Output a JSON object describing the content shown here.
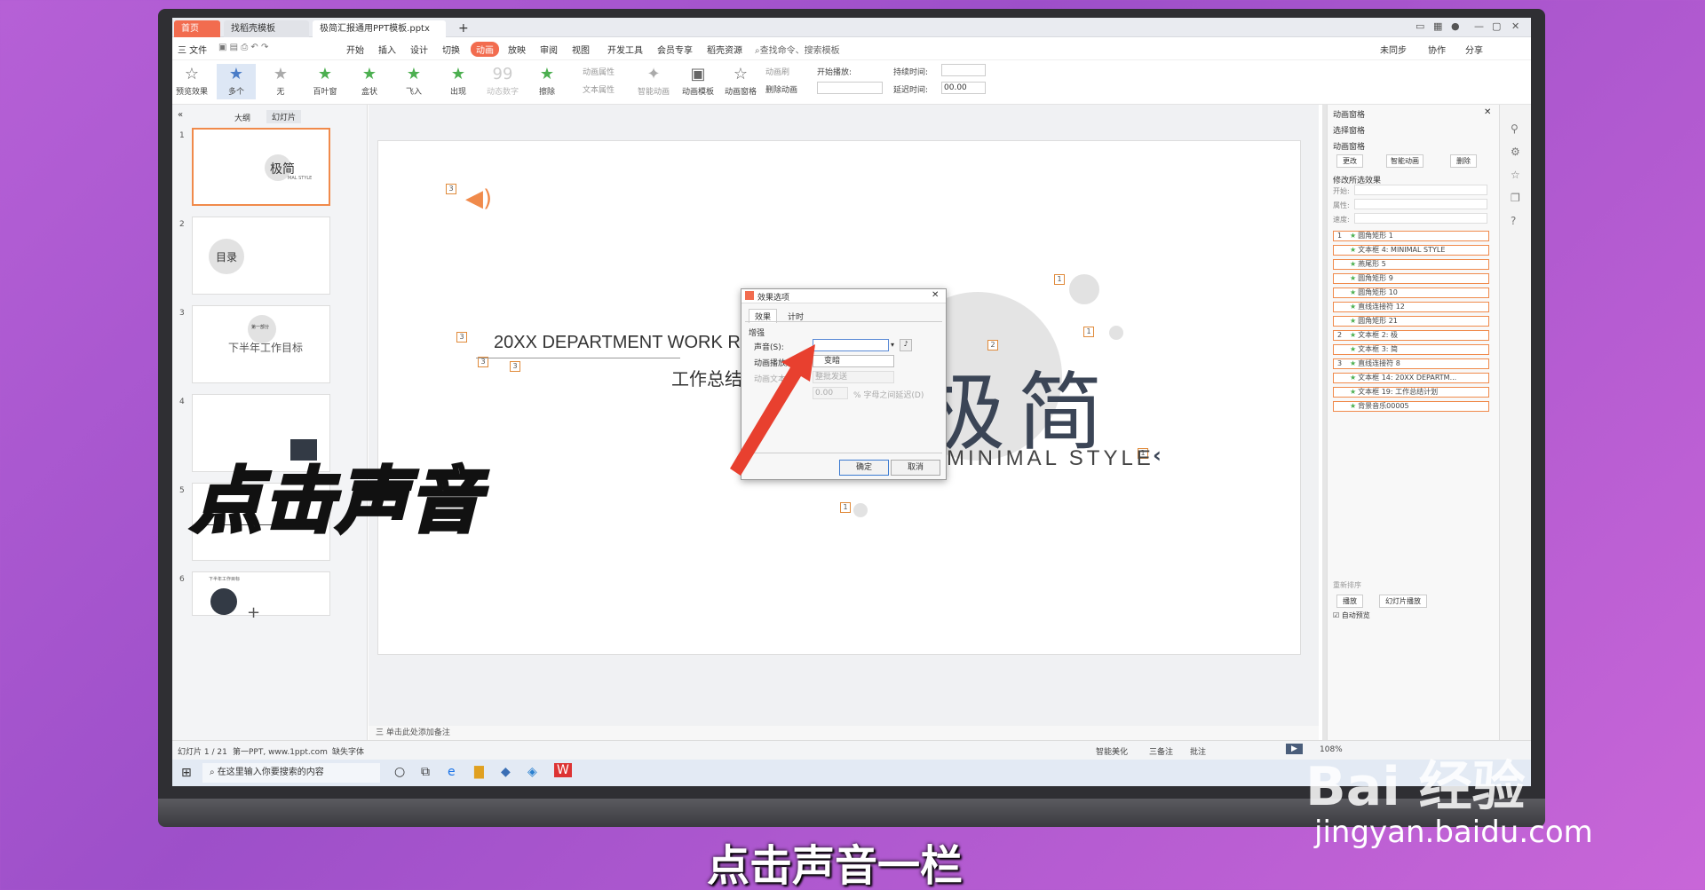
{
  "tabs": {
    "home": "首页",
    "template": "找稻壳模板",
    "file": "极简汇报通用PPT模板.pptx",
    "add": "+"
  },
  "menu": {
    "file": "三 文件",
    "start": "开始",
    "insert": "插入",
    "design": "设计",
    "switch": "切换",
    "animation": "动画",
    "slideshow": "放映",
    "review": "审阅",
    "view": "视图",
    "devtools": "开发工具",
    "member": "会员专享",
    "resource": "稻壳资源",
    "search": "查找命令、搜索模板",
    "unsync": "未同步",
    "collab": "协作",
    "share": "分享"
  },
  "ribbon": {
    "preview": "预览效果",
    "multi": "多个",
    "none": "无",
    "blinds": "百叶窗",
    "box": "盒状",
    "fly": "飞入",
    "appear": "出现",
    "dynamic_num": "动态数字",
    "wipe": "擦除",
    "anim_prop": "动画属性",
    "text_prop": "文本属性",
    "smart_anim": "智能动画",
    "anim_template": "动画模板",
    "anim_pane": "动画窗格",
    "anim_brush": "动画刷",
    "delete_anim": "删除动画",
    "start_play": "开始播放:",
    "duration": "持续时间:",
    "delay": "延迟时间:",
    "delay_value": "00.00"
  },
  "leftpanel": {
    "outline": "大纲",
    "slides": "幻灯片",
    "add": "+",
    "nums": [
      "1",
      "2",
      "3",
      "4",
      "5",
      "6"
    ],
    "slide1_title": "极简",
    "slide1_sub": "MAL STYLE",
    "slide2_title": "目录",
    "slide3_tag": "第一部分",
    "slide3_title": "下半年工作目标",
    "slide5_title": "下半年工作目标",
    "slide6_title": "下半年工作目标"
  },
  "slide": {
    "title_en": "20XX DEPARTMENT WORK R",
    "title_cn": "工作总结",
    "big": "极简",
    "style": "MINIMAL STYLE",
    "tags": [
      "3",
      "3",
      "3",
      "3",
      "1",
      "1",
      "2",
      "1",
      "1"
    ]
  },
  "dialog": {
    "title": "效果选项",
    "tab_effect": "效果",
    "tab_timing": "计时",
    "section": "增强",
    "sound_label": "声音(S):",
    "sound_value": "",
    "after_label": "动画播放后",
    "after_value": "变暗",
    "text_label": "动画文本(",
    "text_value": "整批发送",
    "delay_value": "0.00",
    "delay_suffix": "% 字母之间延迟(D)",
    "ok": "确定",
    "cancel": "取消"
  },
  "rightpanel": {
    "title": "动画窗格",
    "select_pane": "选择窗格",
    "anim_pane": "动画窗格",
    "change": "更改",
    "smart_anim": "智能动画",
    "delete": "删除",
    "modify": "修改所选效果",
    "start": "开始:",
    "prop": "属性:",
    "speed": "速度:",
    "items": [
      {
        "n": "1",
        "t": "圆角矩形 1"
      },
      {
        "n": "",
        "t": "文本框 4: MINIMAL STYLE"
      },
      {
        "n": "",
        "t": "燕尾形 5"
      },
      {
        "n": "",
        "t": "圆角矩形 9"
      },
      {
        "n": "",
        "t": "圆角矩形 10"
      },
      {
        "n": "",
        "t": "直线连接符 12"
      },
      {
        "n": "",
        "t": "圆角矩形 21"
      },
      {
        "n": "2",
        "t": "文本框 2: 极"
      },
      {
        "n": "",
        "t": "文本框 3: 简"
      },
      {
        "n": "3",
        "t": "直线连接符 8"
      },
      {
        "n": "",
        "t": "文本框 14: 20XX DEPARTM..."
      },
      {
        "n": "",
        "t": "文本框 19: 工作总结计划"
      },
      {
        "n": "",
        "t": "背景音乐00005"
      }
    ],
    "reorder": "重新排序",
    "play": "播放",
    "slideshow": "幻灯片播放",
    "autopreview": "自动预览"
  },
  "statusbar": {
    "slide": "幻灯片 1 / 21",
    "theme": "第一PPT, www.1ppt.com",
    "font": "缺失字体",
    "notes_hint": "三 单击此处添加备注",
    "smart": "智能美化",
    "notes": "三备注",
    "comment": "批注",
    "zoom": "108%"
  },
  "taskbar": {
    "search": "在这里输入你要搜索的内容"
  },
  "overlay": {
    "big_caption": "点击声音",
    "sub_caption": "点击声音一栏",
    "brand": "Bai 经验",
    "url": "jingyan.baidu.com"
  },
  "colors": {
    "accent": "#f26c4f",
    "anim_border": "#f08a4b",
    "arrow": "#e8402f"
  }
}
